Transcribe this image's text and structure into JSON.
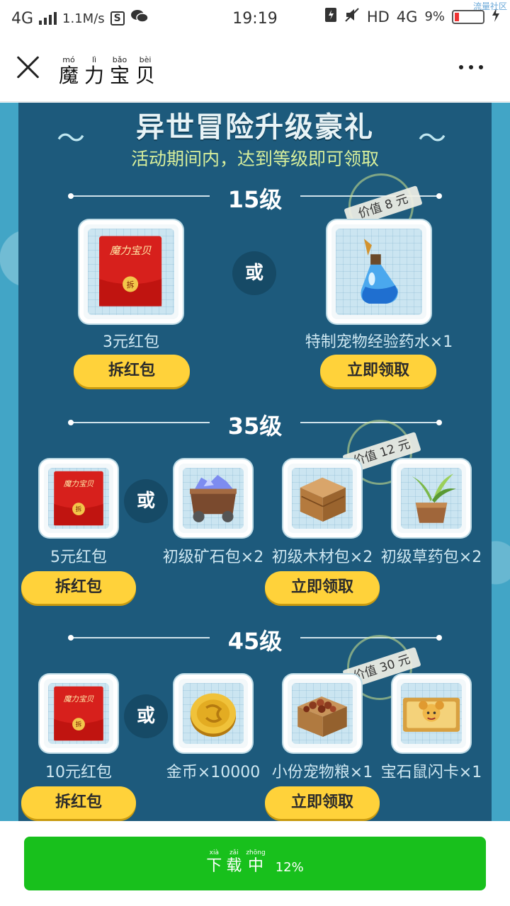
{
  "status": {
    "network": "4G",
    "speed": "1.1M/s",
    "time": "19:19",
    "hd": "HD",
    "net2": "4G",
    "battery": "9%",
    "watermark": "流量社区"
  },
  "titlebar": {
    "title_chars": [
      {
        "py": "mó",
        "hz": "魔"
      },
      {
        "py": "lì",
        "hz": "力"
      },
      {
        "py": "bǎo",
        "hz": "宝"
      },
      {
        "py": "bèi",
        "hz": "贝"
      }
    ]
  },
  "banner": {
    "title": "异世冒险升级豪礼",
    "subtitle": "活动期间内，达到等级即可领取"
  },
  "levels": [
    {
      "level": "15级",
      "redpack_label": "3元红包",
      "redpack_button": "拆红包",
      "or": "或",
      "value_tag": "价值 8 元",
      "items": [
        "特制宠物经验药水×1"
      ],
      "claim_button": "立即领取"
    },
    {
      "level": "35级",
      "redpack_label": "5元红包",
      "redpack_button": "拆红包",
      "or": "或",
      "value_tag": "价值 12 元",
      "items": [
        "初级矿石包×2",
        "初级木材包×2",
        "初级草药包×2"
      ],
      "claim_button": "立即领取"
    },
    {
      "level": "45级",
      "redpack_label": "10元红包",
      "redpack_button": "拆红包",
      "or": "或",
      "value_tag": "价值 30 元",
      "items": [
        "金币×10000",
        "小份宠物粮×1",
        "宝石鼠闪卡×1"
      ],
      "claim_button": "立即领取"
    }
  ],
  "redpack_art": {
    "logo": "魔力宝贝",
    "seal": "拆"
  },
  "download": {
    "chars": [
      {
        "py": "xià",
        "hz": "下"
      },
      {
        "py": "zǎi",
        "hz": "载"
      },
      {
        "py": "zhōng",
        "hz": "中"
      }
    ],
    "progress_text": "12%",
    "progress": 0.12
  },
  "colors": {
    "panel": "#1d5a7c",
    "button": "#ffd23a",
    "download_green": "#18c01c"
  }
}
